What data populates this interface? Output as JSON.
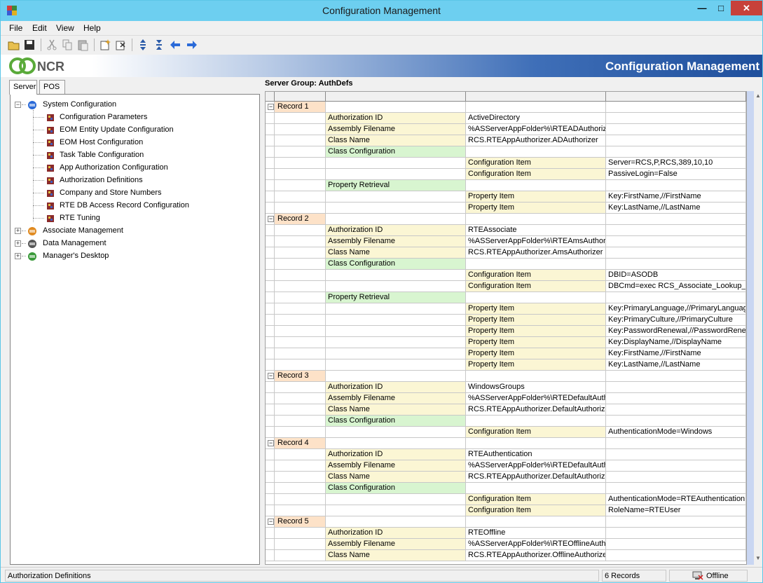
{
  "window": {
    "title": "Configuration Management"
  },
  "menu": [
    "File",
    "Edit",
    "View",
    "Help"
  ],
  "banner": {
    "logo_text": "NCR",
    "title": "Configuration Management"
  },
  "left_tabs": [
    "Server",
    "POS"
  ],
  "tree": [
    {
      "label": "System Configuration",
      "level": 0,
      "expanded": true,
      "icon": "system-config-icon"
    },
    {
      "label": "Configuration Parameters",
      "level": 1,
      "icon": "config-item-icon"
    },
    {
      "label": "EOM Entity Update Configuration",
      "level": 1,
      "icon": "config-item-icon"
    },
    {
      "label": "EOM Host Configuration",
      "level": 1,
      "icon": "config-item-icon"
    },
    {
      "label": "Task Table Configuration",
      "level": 1,
      "icon": "config-item-icon"
    },
    {
      "label": "App Authorization Configuration",
      "level": 1,
      "icon": "config-item-icon"
    },
    {
      "label": "Authorization Definitions",
      "level": 1,
      "icon": "config-item-icon"
    },
    {
      "label": "Company and Store Numbers",
      "level": 1,
      "icon": "config-item-icon"
    },
    {
      "label": "RTE DB Access Record Configuration",
      "level": 1,
      "icon": "config-item-icon"
    },
    {
      "label": "RTE Tuning",
      "level": 1,
      "icon": "config-item-icon"
    },
    {
      "label": "Associate Management",
      "level": 0,
      "expanded": false,
      "icon": "associate-icon"
    },
    {
      "label": "Data Management",
      "level": 0,
      "expanded": false,
      "icon": "data-tools-icon"
    },
    {
      "label": "Manager's Desktop",
      "level": 0,
      "expanded": false,
      "icon": "desktop-globe-icon"
    }
  ],
  "server_group": "Server Group: AuthDefs",
  "grid_rows": [
    {
      "type": "record",
      "label": "Record 1"
    },
    {
      "type": "field",
      "name": "Authorization ID",
      "value": "ActiveDirectory"
    },
    {
      "type": "field",
      "name": "Assembly Filename",
      "value": "%ASServerAppFolder%\\RTEADAuthorize"
    },
    {
      "type": "field",
      "name": "Class Name",
      "value": "RCS.RTEAppAuthorizer.ADAuthorizer"
    },
    {
      "type": "section",
      "name": "Class Configuration"
    },
    {
      "type": "item",
      "name": "Configuration Item",
      "value": "Server=RCS,P,RCS,389,10,10"
    },
    {
      "type": "item",
      "name": "Configuration Item",
      "value": "PassiveLogin=False"
    },
    {
      "type": "section",
      "name": "Property Retrieval"
    },
    {
      "type": "item",
      "name": "Property Item",
      "value": "Key:FirstName,//FirstName"
    },
    {
      "type": "item",
      "name": "Property Item",
      "value": "Key:LastName,//LastName"
    },
    {
      "type": "record",
      "label": "Record 2"
    },
    {
      "type": "field",
      "name": "Authorization ID",
      "value": "RTEAssociate"
    },
    {
      "type": "field",
      "name": "Assembly Filename",
      "value": "%ASServerAppFolder%\\RTEAmsAuthoriz"
    },
    {
      "type": "field",
      "name": "Class Name",
      "value": "RCS.RTEAppAuthorizer.AmsAuthorizer"
    },
    {
      "type": "section",
      "name": "Class Configuration"
    },
    {
      "type": "item",
      "name": "Configuration Item",
      "value": "DBID=ASODB"
    },
    {
      "type": "item",
      "name": "Configuration Item",
      "value": "DBCmd=exec RCS_Associate_Lookup_F"
    },
    {
      "type": "section",
      "name": "Property Retrieval"
    },
    {
      "type": "item",
      "name": "Property Item",
      "value": "Key:PrimaryLanguage,//PrimaryLanguage"
    },
    {
      "type": "item",
      "name": "Property Item",
      "value": "Key:PrimaryCulture,//PrimaryCulture"
    },
    {
      "type": "item",
      "name": "Property Item",
      "value": "Key:PasswordRenewal,//PasswordRene"
    },
    {
      "type": "item",
      "name": "Property Item",
      "value": "Key:DisplayName,//DisplayName"
    },
    {
      "type": "item",
      "name": "Property Item",
      "value": "Key:FirstName,//FirstName"
    },
    {
      "type": "item",
      "name": "Property Item",
      "value": "Key:LastName,//LastName"
    },
    {
      "type": "record",
      "label": "Record 3"
    },
    {
      "type": "field",
      "name": "Authorization ID",
      "value": "WindowsGroups"
    },
    {
      "type": "field",
      "name": "Assembly Filename",
      "value": "%ASServerAppFolder%\\RTEDefaultAuth"
    },
    {
      "type": "field",
      "name": "Class Name",
      "value": "RCS.RTEAppAuthorizer.DefaultAuthorize"
    },
    {
      "type": "section",
      "name": "Class Configuration"
    },
    {
      "type": "item",
      "name": "Configuration Item",
      "value": "AuthenticationMode=Windows"
    },
    {
      "type": "record",
      "label": "Record 4"
    },
    {
      "type": "field",
      "name": "Authorization ID",
      "value": "RTEAuthentication"
    },
    {
      "type": "field",
      "name": "Assembly Filename",
      "value": "%ASServerAppFolder%\\RTEDefaultAuth"
    },
    {
      "type": "field",
      "name": "Class Name",
      "value": "RCS.RTEAppAuthorizer.DefaultAuthorize"
    },
    {
      "type": "section",
      "name": "Class Configuration"
    },
    {
      "type": "item",
      "name": "Configuration Item",
      "value": "AuthenticationMode=RTEAuthentication"
    },
    {
      "type": "item",
      "name": "Configuration Item",
      "value": "RoleName=RTEUser"
    },
    {
      "type": "record",
      "label": "Record 5"
    },
    {
      "type": "field",
      "name": "Authorization ID",
      "value": "RTEOffline"
    },
    {
      "type": "field",
      "name": "Assembly Filename",
      "value": "%ASServerAppFolder%\\RTEOfflineAutho"
    },
    {
      "type": "field",
      "name": "Class Name",
      "value": "RCS.RTEAppAuthorizer.OfflineAuthorizer"
    }
  ],
  "status": {
    "left": "Authorization Definitions",
    "records": "6 Records",
    "connection": "Offline"
  },
  "colors": {
    "titlebar": "#6dcff0",
    "record_cell": "#fde2c8",
    "field_cell": "#fbf6d4",
    "section_cell": "#d8f5d0",
    "close_button": "#c7413a"
  },
  "toolbar_icons": [
    "open-icon",
    "save-icon",
    "cut-icon",
    "copy-icon",
    "paste-icon",
    "new-record-icon",
    "delete-record-icon",
    "expand-all-icon",
    "collapse-all-icon",
    "back-arrow-icon",
    "forward-arrow-icon"
  ]
}
